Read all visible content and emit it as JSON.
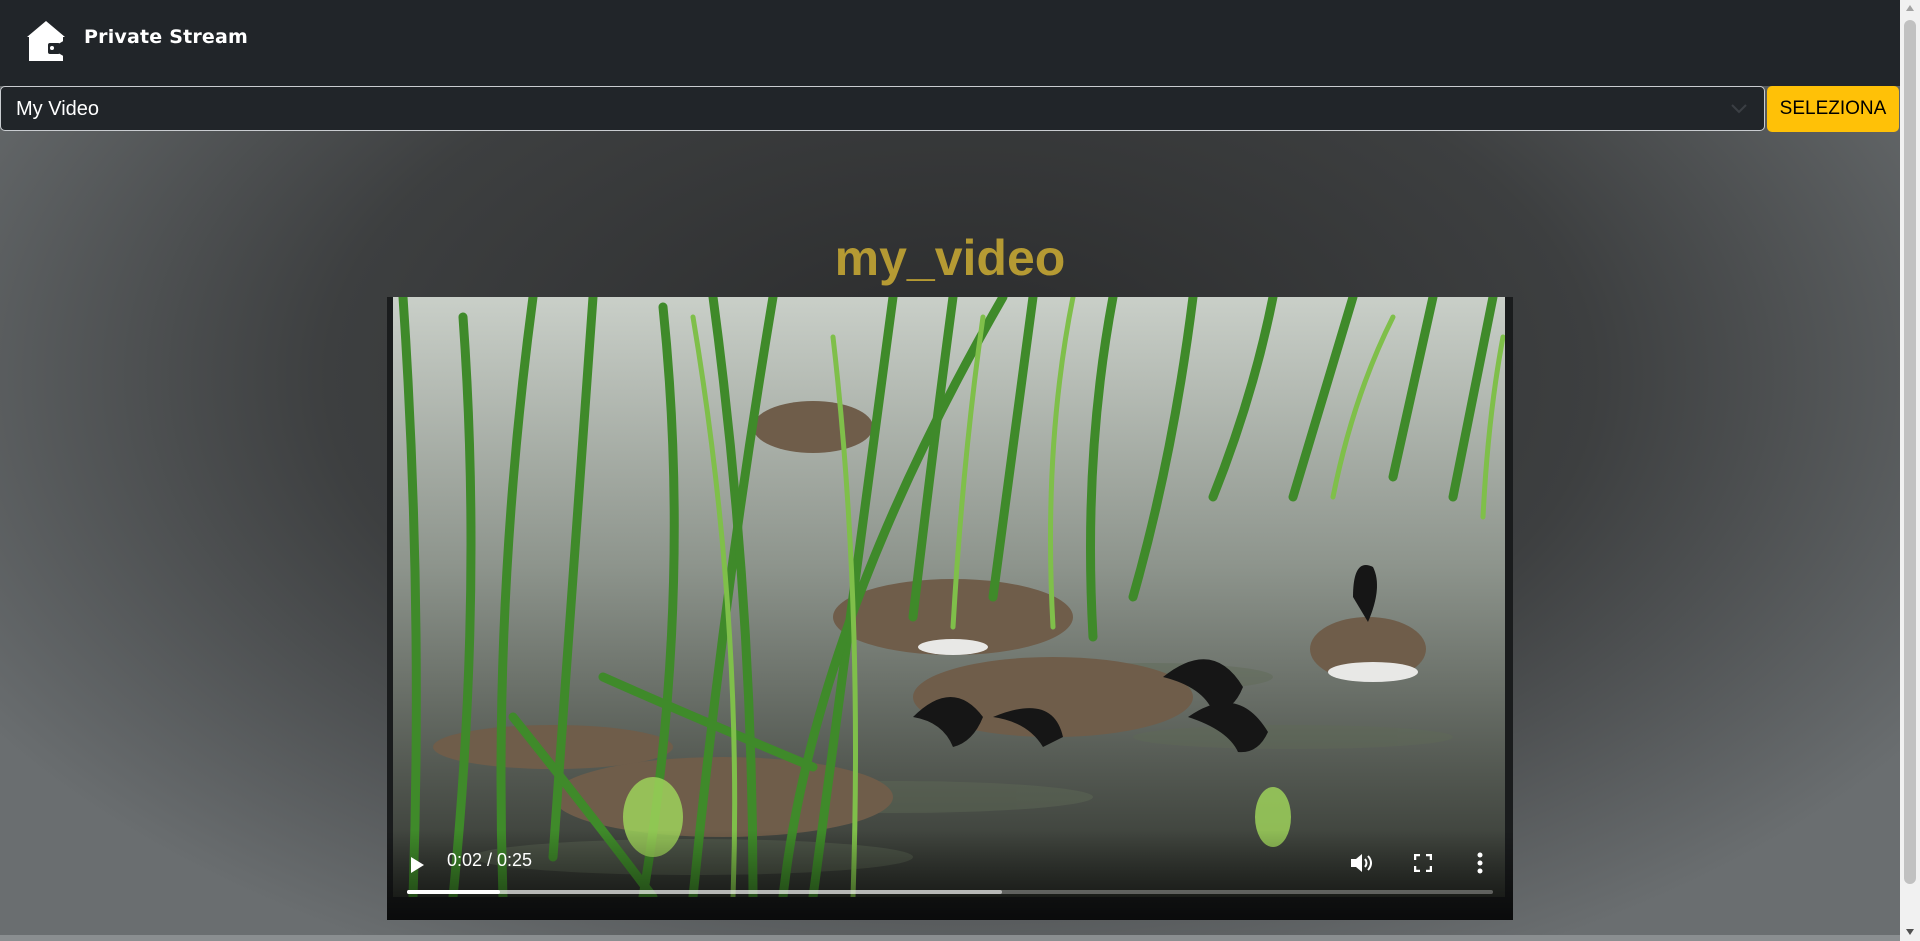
{
  "navbar": {
    "brand": "Private Stream",
    "logo_icon": "home-camera-icon"
  },
  "video_selector": {
    "selected": "My Video",
    "button_label": "SELEZIONA"
  },
  "player": {
    "title": "my_video",
    "time": "0:02 / 0:25",
    "progress": 0.086,
    "buffered": 0.548,
    "controls": [
      "play-icon",
      "volume-icon",
      "fullscreen-icon",
      "more-options-icon"
    ]
  },
  "colors": {
    "navbar_bg": "#212529",
    "accent_button": "#ffc107",
    "title": "#b59a33"
  }
}
